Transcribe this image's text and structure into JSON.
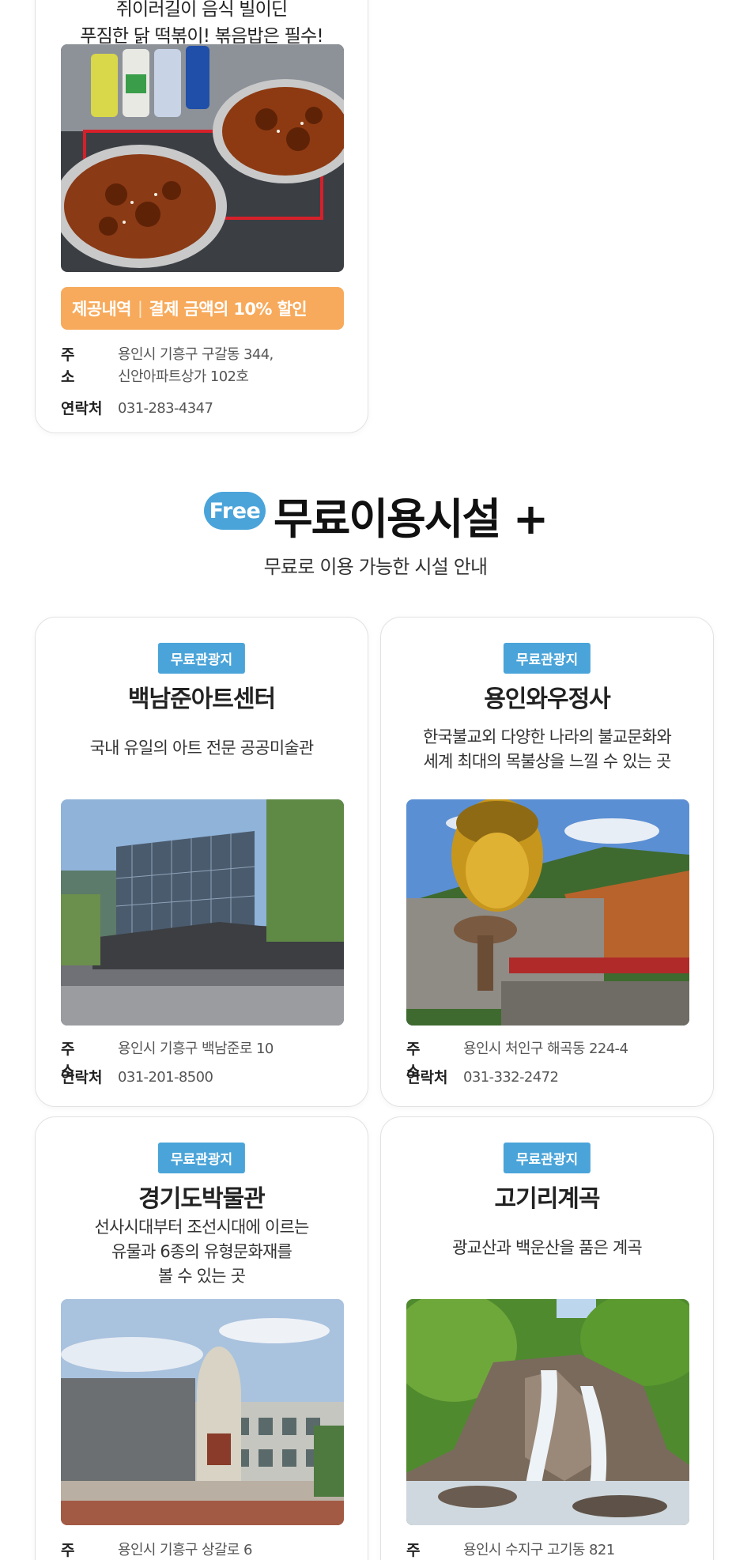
{
  "top_card": {
    "desc_line1": "쥐이러길이 음식 빌이딘",
    "desc_line2": "푸짐한 닭 떡볶이! 볶음밥은 필수!",
    "image_icon": "food-photo",
    "benefit_label": "제공내역",
    "benefit_divider": "|",
    "benefit_text": "결제 금액의 10% 할인",
    "address_label": "주 소",
    "address_value": "용인시 기흥구 구갈동 344,\n신안아파트상가 102호",
    "contact_label": "연락처",
    "contact_value": "031-283-4347"
  },
  "section": {
    "badge": "Free",
    "title": "무료이용시설 +",
    "subtitle": "무료로 이용 가능한 시설 안내"
  },
  "places": [
    {
      "tag": "무료관광지",
      "name": "백남준아트센터",
      "desc": "국내 유일의 아트 전문 공공미술관",
      "image_icon": "art-center-photo",
      "address_label": "주 소",
      "address": "용인시 기흥구 백남준로 10",
      "contact_label": "연락처",
      "contact": "031-201-8500"
    },
    {
      "tag": "무료관광지",
      "name": "용인와우정사",
      "desc": "한국불교외 다양한 나라의 불교문화와\n세계 최대의 목불상을 느낄 수 있는 곳",
      "image_icon": "buddha-statue-photo",
      "address_label": "주 소",
      "address": "용인시 처인구 해곡동 224-4",
      "contact_label": "연락처",
      "contact": "031-332-2472"
    },
    {
      "tag": "무료관광지",
      "name": "경기도박물관",
      "desc": "선사시대부터 조선시대에 이르는\n유물과 6종의 유형문화재를\n볼 수 있는 곳",
      "image_icon": "museum-photo",
      "address_label": "주 소",
      "address": "용인시 기흥구 상갈로 6"
    },
    {
      "tag": "무료관광지",
      "name": "고기리계곡",
      "desc": "광교산과 백운산을 품은 계곡",
      "image_icon": "valley-waterfall-photo",
      "address_label": "주 소",
      "address": "용인시 수지구 고기동 821"
    }
  ],
  "colors": {
    "accent_blue": "#4aa4d9",
    "banner_orange": "#f7aa5b"
  }
}
